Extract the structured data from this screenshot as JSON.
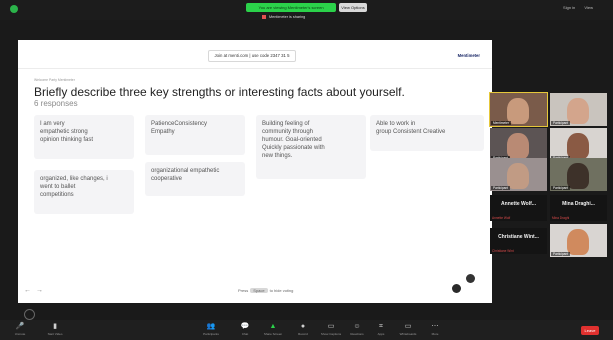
{
  "top": {
    "share_banner": "You are viewing Mentimeter's screen",
    "stop_share": "View Options",
    "note": "Mentimeter is sharing",
    "view_tools": [
      "Sign in",
      "View"
    ]
  },
  "slide": {
    "join_text": "Join at menti.com | use code 2347 31 5",
    "logo": "Mentimeter",
    "eyebrow": "Welcome Party Mentimeter",
    "question": "Briefly describe three key strengths or interesting facts about yourself.",
    "responses": "6 responses",
    "cards": [
      {
        "lines": [
          "I am very",
          "empathetic strong",
          "opinion thinking fast"
        ]
      },
      {
        "lines": [
          "PatienceConsistency",
          "Empathy"
        ]
      },
      {
        "lines": [
          "Building feeling of",
          "community through",
          "humour. Goal-oriented",
          "Quickly passionate with",
          "new things."
        ]
      },
      {
        "lines": [
          "Able to work in",
          "group Consistent Creative"
        ]
      },
      {
        "lines": [
          "organized, like changes, i",
          "went to ballet",
          "competitions"
        ]
      },
      {
        "lines": [
          "organizational empathetic",
          "cooperative"
        ]
      }
    ],
    "hint": {
      "pre": "Press",
      "key": "Space",
      "post": "to hide voting"
    },
    "nav_prev": "←",
    "nav_next": "→"
  },
  "gallery": {
    "tiles": [
      {
        "name": "Mentimeter",
        "bg": "#7a5b4a",
        "face": "#c89a7c",
        "speaking": true
      },
      {
        "name": "Participant",
        "bg": "#c9c4be",
        "face": "#d3a58c",
        "speaking": false
      },
      {
        "name": "Participant",
        "bg": "#5c5454",
        "face": "#b98a74",
        "speaking": false
      },
      {
        "name": "Participant",
        "bg": "#d8d4d0",
        "face": "#8a5a44",
        "speaking": false
      },
      {
        "name": "Participant",
        "bg": "#9a9090",
        "face": "#c19b84",
        "speaking": false
      },
      {
        "name": "Participant",
        "bg": "#6f7060",
        "face": "#3d3129",
        "speaking": false
      }
    ],
    "black_tiles": [
      {
        "name": "Annette Wolf...",
        "sub": "Annette Wolf"
      },
      {
        "name": "Mina Draghi...",
        "sub": "Mina Draghi"
      },
      {
        "name": "Christiane Wint...",
        "sub": "Christiane Wint"
      }
    ],
    "last_tile": {
      "name": "Participant",
      "bg": "#d9d5d2",
      "face": "#d08a5e"
    }
  },
  "toolbar": {
    "items": [
      {
        "glyph": "🎤",
        "label": "Unmute"
      },
      {
        "glyph": "▮",
        "label": "Start Video"
      },
      {
        "glyph": "👥",
        "label": "Participants"
      },
      {
        "glyph": "💬",
        "label": "Chat"
      },
      {
        "glyph": "▲",
        "label": "Share Screen"
      },
      {
        "glyph": "●",
        "label": "Record"
      },
      {
        "glyph": "▭",
        "label": "Show Captions"
      },
      {
        "glyph": "☺",
        "label": "Reactions"
      },
      {
        "glyph": "⌗",
        "label": "Apps"
      },
      {
        "glyph": "▭",
        "label": "Whiteboards"
      },
      {
        "glyph": "⋯",
        "label": "More"
      }
    ],
    "leave": "Leave"
  }
}
